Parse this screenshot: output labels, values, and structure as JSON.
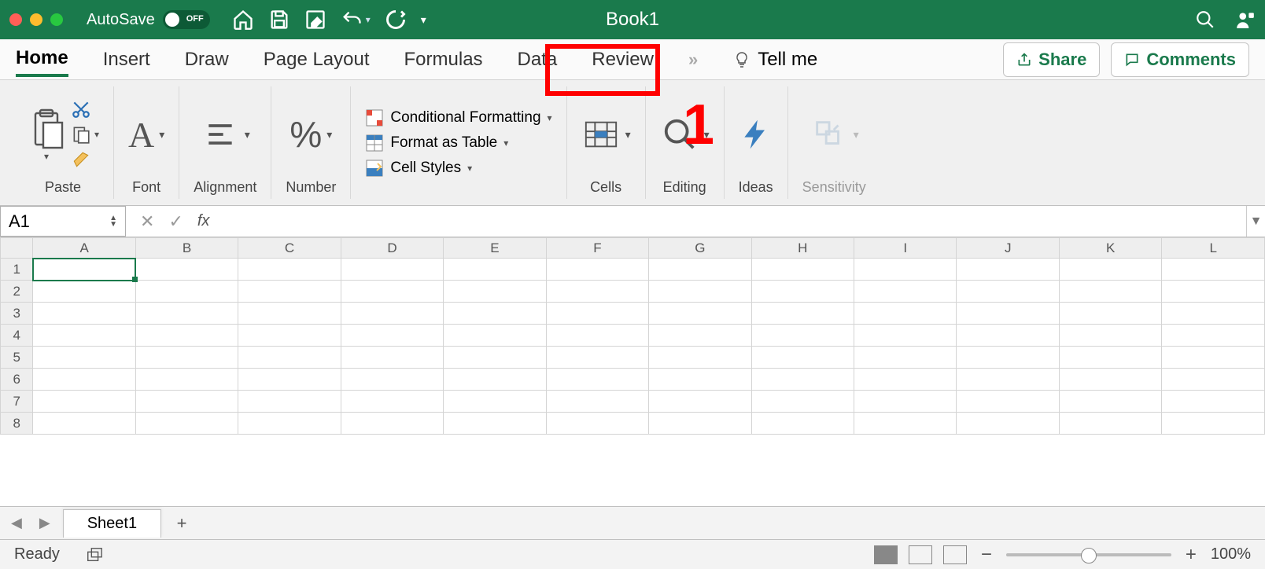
{
  "title_bar": {
    "autosave_label": "AutoSave",
    "autosave_state": "OFF",
    "document_title": "Book1"
  },
  "ribbon_tabs": {
    "items": [
      "Home",
      "Insert",
      "Draw",
      "Page Layout",
      "Formulas",
      "Data",
      "Review"
    ],
    "active": "Home",
    "overflow_glyph": "»",
    "tell_me": "Tell me",
    "share": "Share",
    "comments": "Comments"
  },
  "annotation": {
    "number": "1"
  },
  "ribbon": {
    "paste": "Paste",
    "font": "Font",
    "alignment": "Alignment",
    "number": "Number",
    "conditional_formatting": "Conditional Formatting",
    "format_as_table": "Format as Table",
    "cell_styles": "Cell Styles",
    "cells": "Cells",
    "editing": "Editing",
    "ideas": "Ideas",
    "sensitivity": "Sensitivity"
  },
  "formula_bar": {
    "name_box": "A1",
    "fx": "fx",
    "value": ""
  },
  "grid": {
    "columns": [
      "A",
      "B",
      "C",
      "D",
      "E",
      "F",
      "G",
      "H",
      "I",
      "J",
      "K",
      "L"
    ],
    "rows": [
      1,
      2,
      3,
      4,
      5,
      6,
      7,
      8
    ],
    "selected": "A1"
  },
  "sheet_tabs": {
    "active": "Sheet1"
  },
  "status_bar": {
    "status": "Ready",
    "zoom": "100%"
  }
}
